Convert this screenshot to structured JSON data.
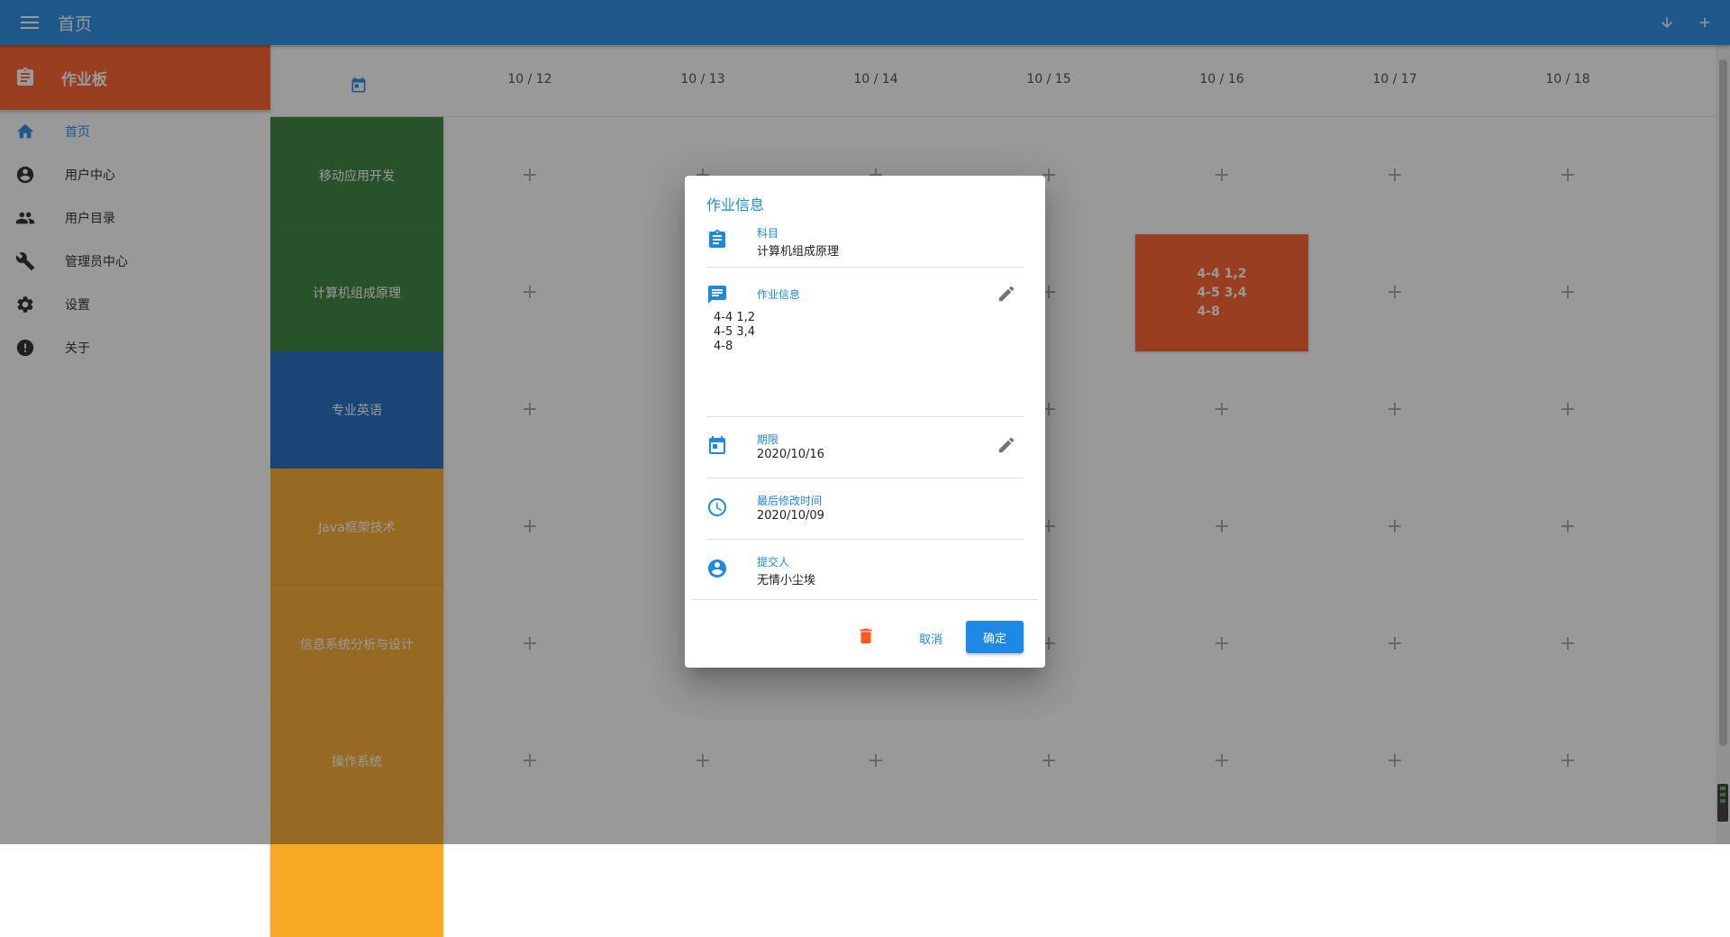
{
  "appbar": {
    "title": "首页",
    "menu_icon": "menu-icon",
    "actions": [
      "arrow-down-icon",
      "add-icon"
    ]
  },
  "sidebar": {
    "header_label": "作业板",
    "header_icon": "clipboard-icon",
    "items": [
      {
        "label": "首页",
        "icon": "home-icon",
        "active": true
      },
      {
        "label": "用户中心",
        "icon": "account-circle-icon",
        "active": false
      },
      {
        "label": "用户目录",
        "icon": "people-icon",
        "active": false
      },
      {
        "label": "管理员中心",
        "icon": "wrench-icon",
        "active": false
      },
      {
        "label": "设置",
        "icon": "gear-icon",
        "active": false
      },
      {
        "label": "关于",
        "icon": "alert-circle-icon",
        "active": false
      }
    ]
  },
  "grid": {
    "days": [
      "10 / 12",
      "10 / 13",
      "10 / 14",
      "10 / 15",
      "10 / 16",
      "10 / 17",
      "10 / 18"
    ],
    "subjects": [
      {
        "name": "移动应用开发",
        "color": "#2e7d32"
      },
      {
        "name": "计算机组成原理",
        "color": "#2e7d32"
      },
      {
        "name": "专业英语",
        "color": "#1565c0"
      },
      {
        "name": "Java框架技术",
        "color": "#f9a825"
      },
      {
        "name": "信息系统分析与设计",
        "color": "#f9a825"
      },
      {
        "name": "操作系统",
        "color": "#f9a825"
      },
      {
        "name": "",
        "color": "#f9a825"
      }
    ],
    "homework": {
      "subject_index": 1,
      "day_index": 4,
      "text": "4-4 1,2\n4-5 3,4\n4-8",
      "color": "#ff5722"
    }
  },
  "dialog": {
    "title": "作业信息",
    "subject_label": "科目",
    "subject_value": "计算机组成原理",
    "info_label": "作业信息",
    "info_text": "4-4 1,2\n4-5 3,4\n4-8",
    "deadline_label": "期限",
    "deadline_value": "2020/10/16",
    "modified_label": "最后修改时间",
    "modified_value": "2020/10/09",
    "submitter_label": "提交人",
    "submitter_value": "无情小尘埃",
    "cancel_label": "取消",
    "ok_label": "确定"
  },
  "colors": {
    "primary": "#1e88e5",
    "accent": "#ff5722"
  }
}
